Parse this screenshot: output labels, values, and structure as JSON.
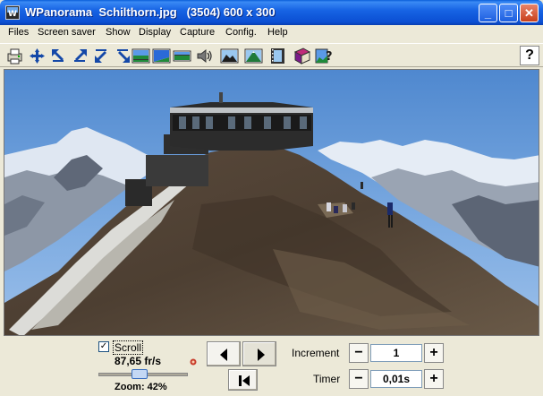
{
  "window": {
    "title": "WPanorama  Schilthorn.jpg   (3504) 600 x 300",
    "icon": "wpanorama-app-icon",
    "buttons": {
      "minimize": "_",
      "maximize": "□",
      "close": "✕"
    }
  },
  "menu": [
    "Files",
    "Screen saver",
    "Show",
    "Display",
    "Capture",
    "Config.",
    "Help"
  ],
  "toolbar": {
    "tools": [
      "print-icon",
      "fit-all-icon",
      "move-up-left-icon",
      "move-up-right-icon",
      "move-down-left-icon",
      "move-down-right-icon",
      "panorama-full-icon",
      "panorama-top-icon",
      "panorama-strip-icon",
      "sound-icon",
      "landscape-icon",
      "mountain-icon",
      "film-icon",
      "book-icon",
      "picture-help-icon"
    ],
    "help_label": "?"
  },
  "controls": {
    "scroll_checked": true,
    "scroll_label": "Scroll",
    "rate": "87,65 fr/s",
    "zoom": "Zoom: 42%",
    "speed_level": 0.45,
    "increment_label": "Increment",
    "increment_value": "1",
    "timer_label": "Timer",
    "timer_value": "0,01s",
    "minus": "−",
    "plus": "+",
    "check_mark": "✓"
  }
}
